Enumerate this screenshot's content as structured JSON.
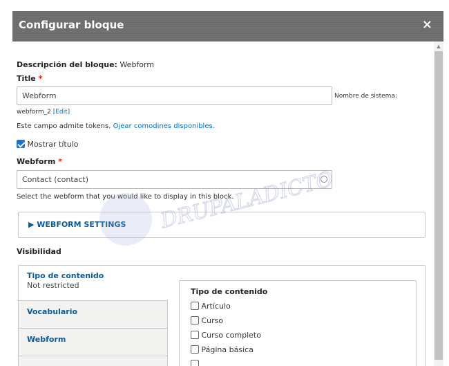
{
  "dialog": {
    "title": "Configurar bloque",
    "close_glyph": "×"
  },
  "form": {
    "description_label": "Descripción del bloque:",
    "description_value": " Webform",
    "title_label": "Title",
    "required_mark": "*",
    "title_value": "Webform",
    "machine_name_label": "Nombre de sistema:",
    "machine_name_value": "webform_2",
    "machine_name_edit": "[Edit]",
    "tokens_text": "Este campo admite tokens.",
    "tokens_link": "Ojear comodines disponibles.",
    "show_title_label": "Mostrar título",
    "show_title_checked": true,
    "webform_label": "Webform",
    "webform_value": "Contact (contact)",
    "webform_help": "Select the webform that you would like to display in this block.",
    "webform_settings_label": "▶ WEBFORM SETTINGS"
  },
  "visibility": {
    "heading": "Visibilidad",
    "tabs": [
      {
        "title": "Tipo de contenido",
        "summary": "Not restricted"
      },
      {
        "title": "Vocabulario",
        "summary": ""
      },
      {
        "title": "Webform",
        "summary": ""
      }
    ],
    "content_types": {
      "legend": "Tipo de contenido",
      "options": [
        {
          "label": "Artículo",
          "checked": false
        },
        {
          "label": "Curso",
          "checked": false
        },
        {
          "label": "Curso completo",
          "checked": false
        },
        {
          "label": "Página básica",
          "checked": false
        },
        {
          "label": "",
          "checked": false
        }
      ]
    }
  },
  "watermark_text": "DRUPALADICTO",
  "colors": {
    "titlebar": "#6d6d6d",
    "link": "#0074bd",
    "required": "#e62600",
    "checkbox": "#1a73c8"
  }
}
